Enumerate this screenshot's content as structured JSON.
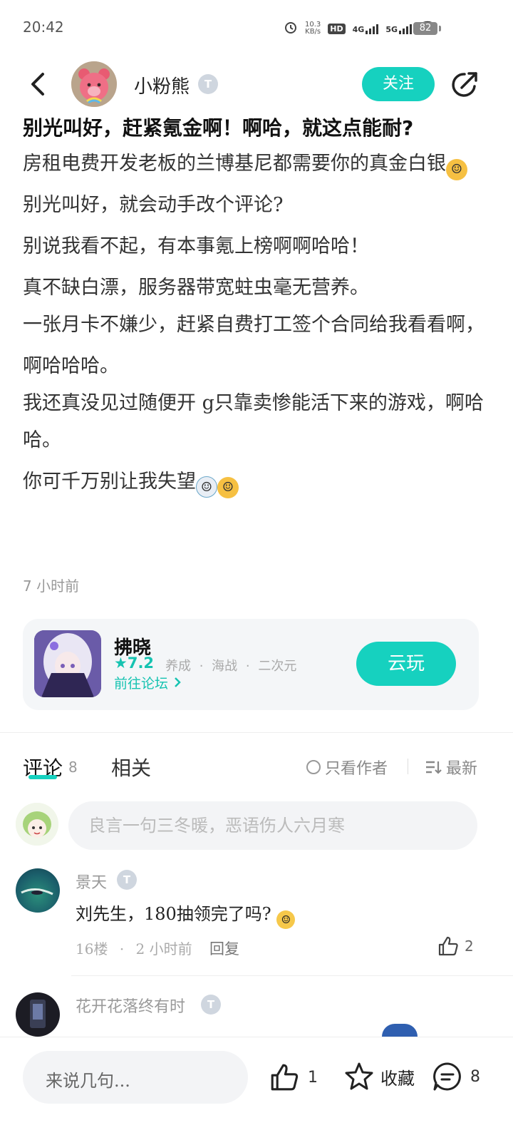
{
  "status_bar": {
    "time": "20:42",
    "net_speed_value": "10.3",
    "net_speed_unit": "KB/s",
    "hd_label": "HD",
    "hd_sub": "1 2",
    "net1": "4G",
    "net2": "5G",
    "battery": "82"
  },
  "header": {
    "author_name": "小粉熊",
    "badge_letter": "T",
    "follow_label": "关注"
  },
  "post": {
    "title": "别光叫好，赶紧氪金啊！啊哈，就这点能耐?",
    "paragraphs": [
      "房租电费开发老板的兰博基尼都需要你的真金白银",
      "别光叫好，就会动手改个评论?",
      "别说我看不起，有本事氪上榜啊啊哈哈！",
      "真不缺白漂，服务器带宽蛀虫毫无营养。",
      "一张月卡不嫌少，赶紧自费打工签个合同给我看看啊，",
      "啊哈哈哈。",
      "我还真没见过随便开 g只靠卖惨能活下来的游戏，啊哈哈。",
      "你可千万别让我失望"
    ],
    "time_ago": "7 小时前"
  },
  "game_card": {
    "name": "拂晓",
    "rating": "7.2",
    "tags": "养成 · 海战 · 二次元",
    "forum_link": "前往论坛",
    "cloud_play": "云玩"
  },
  "comments_section": {
    "tab_comments": "评论",
    "comment_count": "8",
    "tab_related": "相关",
    "only_author": "只看作者",
    "sort_label": "最新",
    "input_placeholder": "良言一句三冬暖，恶语伤人六月寒"
  },
  "comments": [
    {
      "user": "景天",
      "text": "刘先生，180抽领完了吗?",
      "floor": "16楼",
      "time": "2 小时前",
      "reply": "回复",
      "likes": "2"
    },
    {
      "user": "花开花落终有时"
    }
  ],
  "bottom_bar": {
    "input_hint": "来说几句...",
    "like_count": "1",
    "favorite_label": "收藏",
    "comment_count": "8"
  },
  "colors": {
    "accent": "#16d1bf",
    "text_primary": "#222222",
    "text_muted": "#999999"
  }
}
